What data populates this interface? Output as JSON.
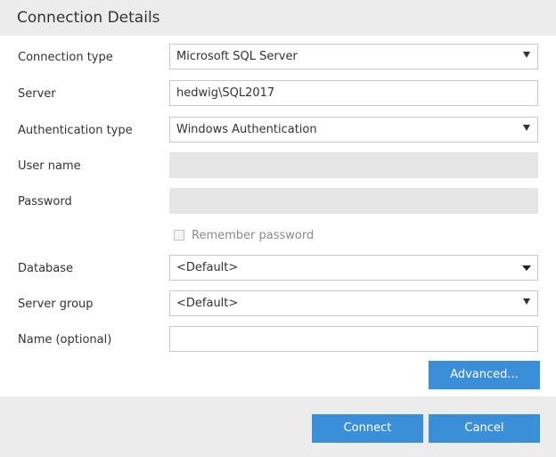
{
  "header": {
    "title": "Connection Details"
  },
  "form": {
    "connection_type": {
      "label": "Connection type",
      "value": "Microsoft SQL Server"
    },
    "server": {
      "label": "Server",
      "value": "hedwig\\SQL2017"
    },
    "auth_type": {
      "label": "Authentication type",
      "value": "Windows Authentication"
    },
    "user_name": {
      "label": "User name",
      "value": ""
    },
    "password": {
      "label": "Password",
      "value": ""
    },
    "remember_password": {
      "label": "Remember password",
      "checked": false
    },
    "database": {
      "label": "Database",
      "value": "<Default>"
    },
    "server_group": {
      "label": "Server group",
      "value": "<Default>"
    },
    "name": {
      "label": "Name (optional)",
      "value": ""
    }
  },
  "buttons": {
    "advanced": "Advanced...",
    "connect": "Connect",
    "cancel": "Cancel"
  },
  "colors": {
    "accent": "#3b8fd9",
    "header_bg": "#ececec",
    "disabled_field": "#e6e6e6"
  }
}
